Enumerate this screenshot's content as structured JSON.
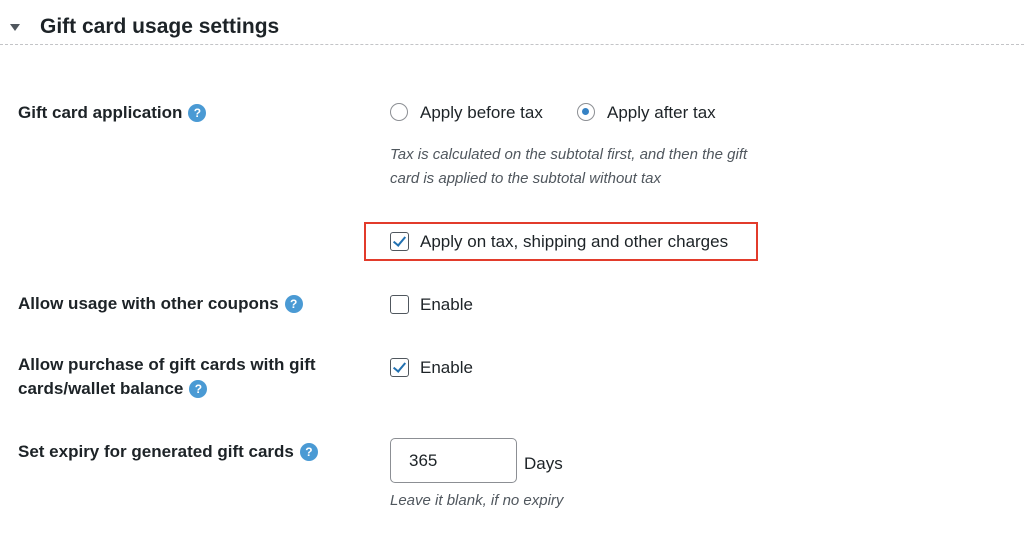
{
  "section": {
    "title": "Gift card usage settings"
  },
  "rows": {
    "application": {
      "label": "Gift card application",
      "help": "?",
      "option_before": "Apply before tax",
      "option_after": "Apply after tax",
      "selected": "Apply after tax",
      "description_line1": "Tax is calculated on the subtotal first, and then the gift",
      "description_line2": "card is applied to the subtotal without tax",
      "charges_label": "Apply on tax, shipping and other charges",
      "charges_checked": true
    },
    "coupons": {
      "label": "Allow usage with other coupons",
      "help": "?",
      "checkbox_label": "Enable",
      "checked": false
    },
    "purchase": {
      "label_line1": "Allow purchase of gift cards with gift",
      "label_line2": "cards/wallet balance",
      "help": "?",
      "checkbox_label": "Enable",
      "checked": true
    },
    "expiry": {
      "label": "Set expiry for generated gift cards",
      "help": "?",
      "value": "365",
      "unit": "Days",
      "description": "Leave it blank, if no expiry"
    }
  },
  "colors": {
    "highlight": "#e23b2b",
    "accent": "#2271b1",
    "help_icon": "#4a9ad4"
  },
  "icons": {
    "toggle": "triangle-down-icon",
    "help": "question-circle-icon"
  }
}
